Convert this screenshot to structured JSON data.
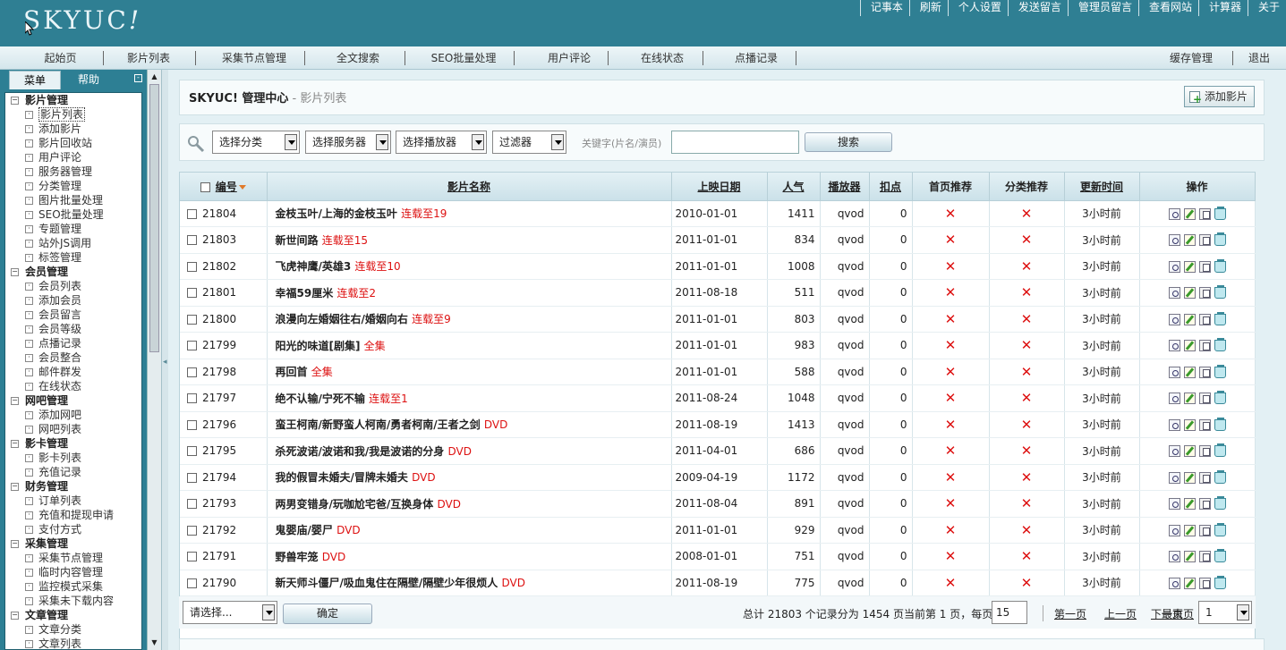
{
  "logo": {
    "main": "SKYUC",
    "mark": "!"
  },
  "toplinks": [
    "记事本",
    "刷新",
    "个人设置",
    "发送留言",
    "管理员留言",
    "查看网站",
    "计算器",
    "关于"
  ],
  "nav": {
    "left": [
      "起始页",
      "影片列表",
      "采集节点管理",
      "全文搜索",
      "SEO批量处理",
      "用户评论",
      "在线状态",
      "点播记录"
    ],
    "right": [
      "缓存管理",
      "退出"
    ]
  },
  "sidebar": {
    "tabs": [
      "菜单",
      "帮助"
    ],
    "collapse": "-",
    "groups": [
      {
        "title": "影片管理",
        "items": [
          "影片列表",
          "添加影片",
          "影片回收站",
          "用户评论",
          "服务器管理",
          "分类管理",
          "图片批量处理",
          "SEO批量处理",
          "专题管理",
          "站外JS调用",
          "标签管理"
        ]
      },
      {
        "title": "会员管理",
        "items": [
          "会员列表",
          "添加会员",
          "会员留言",
          "会员等级",
          "点播记录",
          "会员整合",
          "邮件群发",
          "在线状态"
        ]
      },
      {
        "title": "网吧管理",
        "items": [
          "添加网吧",
          "网吧列表"
        ]
      },
      {
        "title": "影卡管理",
        "items": [
          "影卡列表",
          "充值记录"
        ]
      },
      {
        "title": "财务管理",
        "items": [
          "订单列表",
          "充值和提现申请",
          "支付方式"
        ]
      },
      {
        "title": "采集管理",
        "items": [
          "采集节点管理",
          "临时内容管理",
          "监控模式采集",
          "采集未下载内容"
        ]
      },
      {
        "title": "文章管理",
        "items": [
          "文章分类",
          "文章列表"
        ]
      }
    ]
  },
  "header": {
    "title": "SKYUC! 管理中心",
    "subtitle": " - 影片列表",
    "add_button": "添加影片"
  },
  "filters": {
    "category": "选择分类",
    "server": "选择服务器",
    "player": "选择播放器",
    "filter": "过滤器",
    "keyword_label": "关键字(片名/演员)",
    "keyword_value": "",
    "search_button": "搜索"
  },
  "table": {
    "columns": [
      "编号",
      "影片名称",
      "上映日期",
      "人气",
      "播放器",
      "扣点",
      "首页推荐",
      "分类推荐",
      "更新时间",
      "操作"
    ],
    "rows": [
      {
        "id": "21804",
        "name": "金枝玉叶/上海的金枝玉叶",
        "status": "连载至19",
        "date": "2010-01-01",
        "pop": "1411",
        "player": "qvod",
        "points": "0",
        "home": "✕",
        "cat": "✕",
        "updated": "3小时前"
      },
      {
        "id": "21803",
        "name": "新世间路",
        "status": "连载至15",
        "date": "2011-01-01",
        "pop": "834",
        "player": "qvod",
        "points": "0",
        "home": "✕",
        "cat": "✕",
        "updated": "3小时前"
      },
      {
        "id": "21802",
        "name": "飞虎神鹰/英雄3",
        "status": "连载至10",
        "date": "2011-01-01",
        "pop": "1008",
        "player": "qvod",
        "points": "0",
        "home": "✕",
        "cat": "✕",
        "updated": "3小时前"
      },
      {
        "id": "21801",
        "name": "幸福59厘米",
        "status": "连载至2",
        "date": "2011-08-18",
        "pop": "511",
        "player": "qvod",
        "points": "0",
        "home": "✕",
        "cat": "✕",
        "updated": "3小时前"
      },
      {
        "id": "21800",
        "name": "浪漫向左婚姻往右/婚姻向右",
        "status": "连载至9",
        "date": "2011-01-01",
        "pop": "803",
        "player": "qvod",
        "points": "0",
        "home": "✕",
        "cat": "✕",
        "updated": "3小时前"
      },
      {
        "id": "21799",
        "name": "阳光的味道[剧集]",
        "status": "全集",
        "date": "2011-01-01",
        "pop": "983",
        "player": "qvod",
        "points": "0",
        "home": "✕",
        "cat": "✕",
        "updated": "3小时前"
      },
      {
        "id": "21798",
        "name": "再回首",
        "status": "全集",
        "date": "2011-01-01",
        "pop": "588",
        "player": "qvod",
        "points": "0",
        "home": "✕",
        "cat": "✕",
        "updated": "3小时前"
      },
      {
        "id": "21797",
        "name": "绝不认输/宁死不输",
        "status": "连载至1",
        "date": "2011-08-24",
        "pop": "1048",
        "player": "qvod",
        "points": "0",
        "home": "✕",
        "cat": "✕",
        "updated": "3小时前"
      },
      {
        "id": "21796",
        "name": "蛮王柯南/新野蛮人柯南/勇者柯南/王者之剑",
        "status": "DVD",
        "date": "2011-08-19",
        "pop": "1413",
        "player": "qvod",
        "points": "0",
        "home": "✕",
        "cat": "✕",
        "updated": "3小时前"
      },
      {
        "id": "21795",
        "name": "杀死波诺/波诺和我/我是波诺的分身",
        "status": "DVD",
        "date": "2011-04-01",
        "pop": "686",
        "player": "qvod",
        "points": "0",
        "home": "✕",
        "cat": "✕",
        "updated": "3小时前"
      },
      {
        "id": "21794",
        "name": "我的假冒未婚夫/冒牌未婚夫",
        "status": "DVD",
        "date": "2009-04-19",
        "pop": "1172",
        "player": "qvod",
        "points": "0",
        "home": "✕",
        "cat": "✕",
        "updated": "3小时前"
      },
      {
        "id": "21793",
        "name": "两男变错身/玩咖尬宅爸/互换身体",
        "status": "DVD",
        "date": "2011-08-04",
        "pop": "891",
        "player": "qvod",
        "points": "0",
        "home": "✕",
        "cat": "✕",
        "updated": "3小时前"
      },
      {
        "id": "21792",
        "name": "鬼婴庙/婴尸",
        "status": "DVD",
        "date": "2011-01-01",
        "pop": "929",
        "player": "qvod",
        "points": "0",
        "home": "✕",
        "cat": "✕",
        "updated": "3小时前"
      },
      {
        "id": "21791",
        "name": "野兽牢笼",
        "status": "DVD",
        "date": "2008-01-01",
        "pop": "751",
        "player": "qvod",
        "points": "0",
        "home": "✕",
        "cat": "✕",
        "updated": "3小时前"
      },
      {
        "id": "21790",
        "name": "新天师斗僵尸/吸血鬼住在隔壁/隔壁少年很烦人",
        "status": "DVD",
        "date": "2011-08-19",
        "pop": "775",
        "player": "qvod",
        "points": "0",
        "home": "✕",
        "cat": "✕",
        "updated": "3小时前"
      }
    ]
  },
  "bottom": {
    "batch_select": "请选择...",
    "ok_button": "确定",
    "pager_text": "总计 21803 个记录分为 1454 页当前第 1 页，每页",
    "per_page": "15",
    "first": "第一页",
    "prev": "上一页",
    "next": "下一页",
    "last": "最末页",
    "page": "1"
  }
}
